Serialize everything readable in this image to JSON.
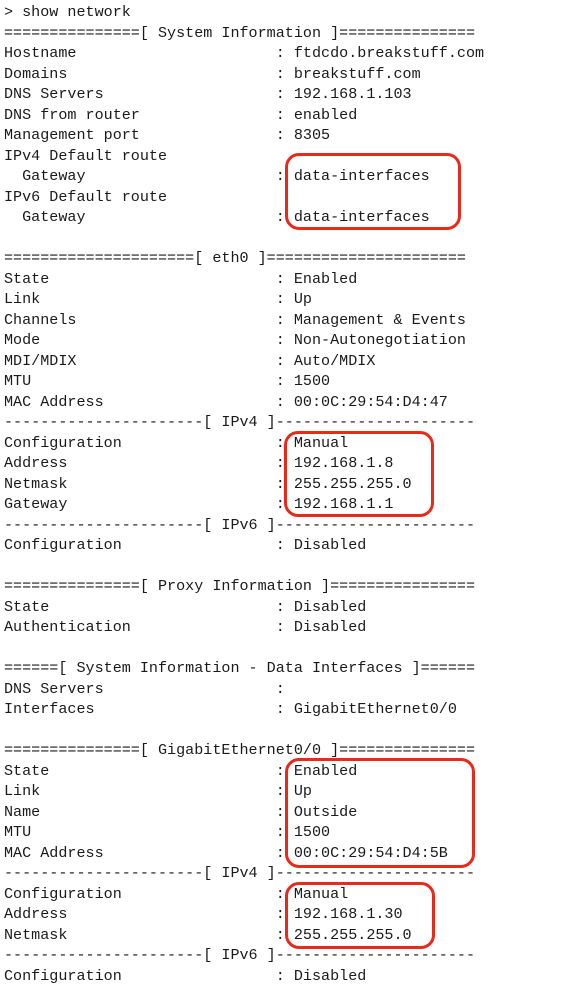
{
  "prompt": "> show network",
  "highlight_color": "#e8291c",
  "lines": [
    {
      "type": "cmd",
      "text": "> show network"
    },
    {
      "type": "header",
      "text": "===============[ System Information ]==============="
    },
    {
      "type": "kv",
      "key": "Hostname",
      "value": "ftdcdo.breakstuff.com"
    },
    {
      "type": "kv",
      "key": "Domains",
      "value": "breakstuff.com"
    },
    {
      "type": "kv",
      "key": "DNS Servers",
      "value": "192.168.1.103"
    },
    {
      "type": "kv",
      "key": "DNS from router",
      "value": "enabled"
    },
    {
      "type": "kv",
      "key": "Management port",
      "value": "8305"
    },
    {
      "type": "label",
      "text": "IPv4 Default route"
    },
    {
      "type": "kv",
      "key": "  Gateway",
      "value": "data-interfaces"
    },
    {
      "type": "label",
      "text": "IPv6 Default route"
    },
    {
      "type": "kv",
      "key": "  Gateway",
      "value": "data-interfaces"
    },
    {
      "type": "blank",
      "text": ""
    },
    {
      "type": "header",
      "text": "=====================[ eth0 ]======================"
    },
    {
      "type": "kv",
      "key": "State",
      "value": "Enabled"
    },
    {
      "type": "kv",
      "key": "Link",
      "value": "Up"
    },
    {
      "type": "kv",
      "key": "Channels",
      "value": "Management & Events"
    },
    {
      "type": "kv",
      "key": "Mode",
      "value": "Non-Autonegotiation"
    },
    {
      "type": "kv",
      "key": "MDI/MDIX",
      "value": "Auto/MDIX"
    },
    {
      "type": "kv",
      "key": "MTU",
      "value": "1500"
    },
    {
      "type": "kv",
      "key": "MAC Address",
      "value": "00:0C:29:54:D4:47"
    },
    {
      "type": "header",
      "text": "----------------------[ IPv4 ]----------------------"
    },
    {
      "type": "kv",
      "key": "Configuration",
      "value": "Manual"
    },
    {
      "type": "kv",
      "key": "Address",
      "value": "192.168.1.8"
    },
    {
      "type": "kv",
      "key": "Netmask",
      "value": "255.255.255.0"
    },
    {
      "type": "kv",
      "key": "Gateway",
      "value": "192.168.1.1"
    },
    {
      "type": "header",
      "text": "----------------------[ IPv6 ]----------------------"
    },
    {
      "type": "kv",
      "key": "Configuration",
      "value": "Disabled"
    },
    {
      "type": "blank",
      "text": ""
    },
    {
      "type": "header",
      "text": "===============[ Proxy Information ]================"
    },
    {
      "type": "kv",
      "key": "State",
      "value": "Disabled"
    },
    {
      "type": "kv",
      "key": "Authentication",
      "value": "Disabled"
    },
    {
      "type": "blank",
      "text": ""
    },
    {
      "type": "header",
      "text": "======[ System Information - Data Interfaces ]======"
    },
    {
      "type": "kv",
      "key": "DNS Servers",
      "value": ""
    },
    {
      "type": "kv",
      "key": "Interfaces",
      "value": "GigabitEthernet0/0"
    },
    {
      "type": "blank",
      "text": ""
    },
    {
      "type": "header",
      "text": "===============[ GigabitEthernet0/0 ]==============="
    },
    {
      "type": "kv",
      "key": "State",
      "value": "Enabled"
    },
    {
      "type": "kv",
      "key": "Link",
      "value": "Up"
    },
    {
      "type": "kv",
      "key": "Name",
      "value": "Outside"
    },
    {
      "type": "kv",
      "key": "MTU",
      "value": "1500"
    },
    {
      "type": "kv",
      "key": "MAC Address",
      "value": "00:0C:29:54:D4:5B"
    },
    {
      "type": "header",
      "text": "----------------------[ IPv4 ]----------------------"
    },
    {
      "type": "kv",
      "key": "Configuration",
      "value": "Manual"
    },
    {
      "type": "kv",
      "key": "Address",
      "value": "192.168.1.30"
    },
    {
      "type": "kv",
      "key": "Netmask",
      "value": "255.255.255.0"
    },
    {
      "type": "header",
      "text": "----------------------[ IPv6 ]----------------------"
    },
    {
      "type": "kv",
      "key": "Configuration",
      "value": "Disabled"
    }
  ],
  "highlights": [
    {
      "label": "default-route-gateways"
    },
    {
      "label": "eth0-ipv4-settings"
    },
    {
      "label": "gig0-0-interface-settings"
    },
    {
      "label": "gig0-0-ipv4-settings"
    }
  ]
}
